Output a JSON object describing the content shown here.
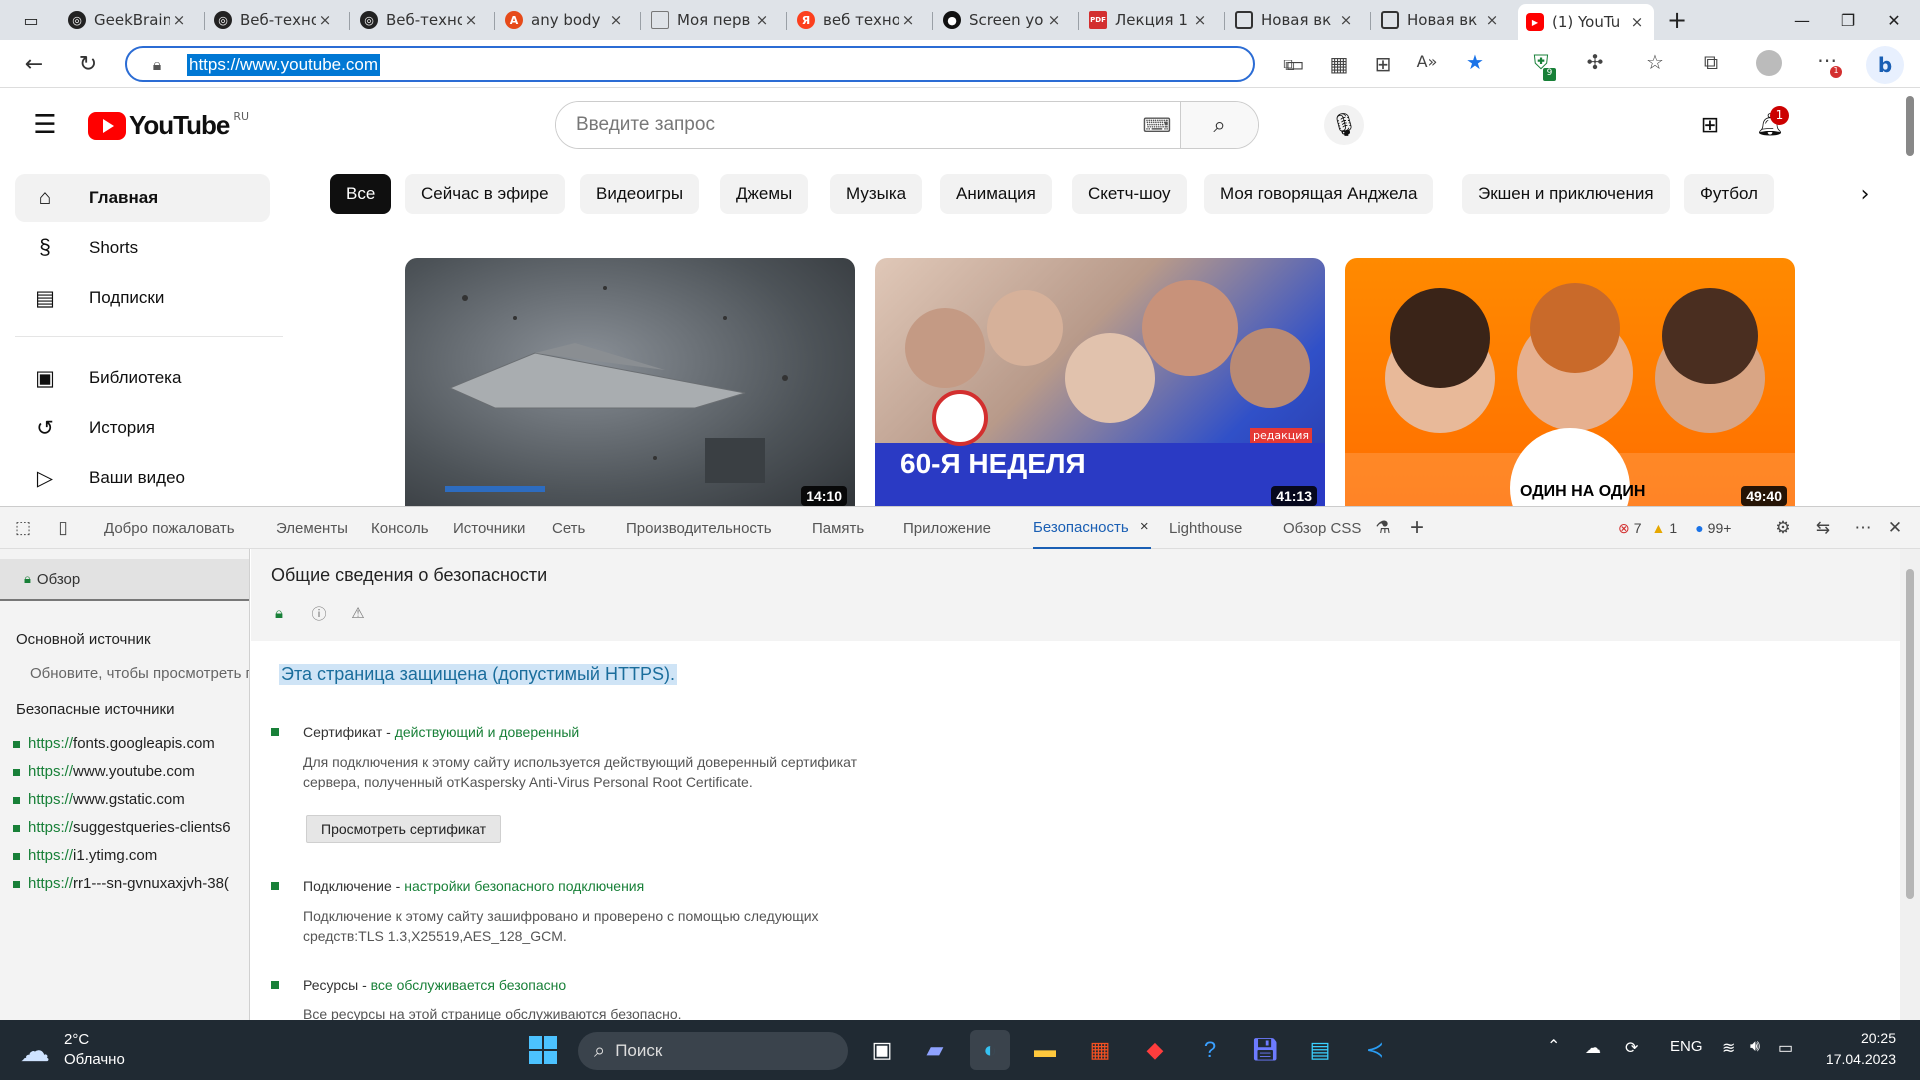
{
  "browser": {
    "tabs": [
      {
        "title": "GeekBrains",
        "favicon": "openai-icon",
        "close": "×"
      },
      {
        "title": "Веб-техно",
        "favicon": "openai-icon",
        "close": "×"
      },
      {
        "title": "Веб-техно",
        "favicon": "openai-icon",
        "close": "×"
      },
      {
        "title": "any body",
        "favicon": "red-circle-icon",
        "close": "×"
      },
      {
        "title": "Моя перв",
        "favicon": "file-icon",
        "close": "×"
      },
      {
        "title": "веб техно",
        "favicon": "yandex-icon",
        "close": "×"
      },
      {
        "title": "Screen yo",
        "favicon": "github-icon",
        "close": "×"
      },
      {
        "title": "Лекция 1",
        "favicon": "pdf-icon",
        "close": "×"
      },
      {
        "title": "Новая вк",
        "favicon": "tab-icon",
        "close": "×"
      },
      {
        "title": "Новая вк",
        "favicon": "tab-icon",
        "close": "×"
      },
      {
        "title": "(1) YouTu",
        "favicon": "youtube-icon",
        "close": "×"
      }
    ],
    "new_tab": "+",
    "address": {
      "url": "https://www.youtube.com"
    },
    "extension_badge": "9",
    "notification_badge": "1"
  },
  "youtube": {
    "logo_text": "YouTube",
    "region": "RU",
    "search_placeholder": "Введите запрос",
    "notification_count": "1",
    "sidebar": [
      {
        "label": "Главная",
        "icon": "home-icon"
      },
      {
        "label": "Shorts",
        "icon": "shorts-icon"
      },
      {
        "label": "Подписки",
        "icon": "subscriptions-icon"
      },
      {
        "label": "Библиотека",
        "icon": "library-icon"
      },
      {
        "label": "История",
        "icon": "history-icon"
      },
      {
        "label": "Ваши видео",
        "icon": "your-videos-icon"
      }
    ],
    "chips": [
      "Все",
      "Сейчас в эфире",
      "Видеоигры",
      "Джемы",
      "Музыка",
      "Анимация",
      "Скетч-шоу",
      "Моя говорящая Анджела",
      "Экшен и приключения",
      "Футбол"
    ],
    "videos": [
      {
        "duration": "14:10",
        "overlay": ""
      },
      {
        "duration": "41:13",
        "overlay": "60-Я НЕДЕЛЯ",
        "badge": "редакция"
      },
      {
        "duration": "49:40",
        "overlay": "ОДИН НА ОДИН"
      }
    ]
  },
  "devtools": {
    "tabs": [
      "Добро пожаловать",
      "Элементы",
      "Консоль",
      "Источники",
      "Сеть",
      "Производительность",
      "Память",
      "Приложение",
      "Безопасность",
      "Lighthouse",
      "Обзор CSS"
    ],
    "active_tab": "Безопасность",
    "counters": {
      "errors": "7",
      "warnings": "1",
      "messages": "99+"
    },
    "sidebar": {
      "overview": "Обзор",
      "main_origin_heading": "Основной источник",
      "main_origin_note": "Обновите, чтобы просмотреть г",
      "secure_heading": "Безопасные источники",
      "origins": [
        {
          "scheme": "https://",
          "host": "fonts.googleapis.com"
        },
        {
          "scheme": "https://",
          "host": "www.youtube.com"
        },
        {
          "scheme": "https://",
          "host": "www.gstatic.com"
        },
        {
          "scheme": "https://",
          "host": "suggestqueries-clients6"
        },
        {
          "scheme": "https://",
          "host": "i1.ytimg.com"
        },
        {
          "scheme": "https://",
          "host": "rr1---sn-gvnuxaxjvh-38("
        }
      ]
    },
    "main": {
      "title": "Общие сведения о безопасности",
      "secure_text": "Эта страница защищена (допустимый HTTPS).",
      "certificate": {
        "label": "Сертификат - ",
        "status": "действующий и доверенный",
        "desc": "Для подключения к этому сайту используется действующий доверенный сертификат сервера, полученный отKaspersky Anti-Virus Personal Root Certificate.",
        "button": "Просмотреть сертификат"
      },
      "connection": {
        "label": "Подключение - ",
        "status": "настройки безопасного подключения",
        "desc": "Подключение к этому сайту зашифровано и проверено с помощью следующих средств:TLS 1.3,X25519,AES_128_GCM."
      },
      "resources": {
        "label": "Ресурсы - ",
        "status": "все обслуживается безопасно",
        "desc": "Все ресурсы на этой странице обслуживаются безопасно."
      }
    }
  },
  "taskbar": {
    "weather": {
      "temp": "2°C",
      "desc": "Облачно"
    },
    "search": "Поиск",
    "lang": "ENG",
    "time": "20:25",
    "date": "17.04.2023"
  },
  "colors": {
    "accent": "#0078d4",
    "yt_red": "#ff0000",
    "secure_green": "#188038",
    "devtools_blue": "#1a5fb4"
  }
}
